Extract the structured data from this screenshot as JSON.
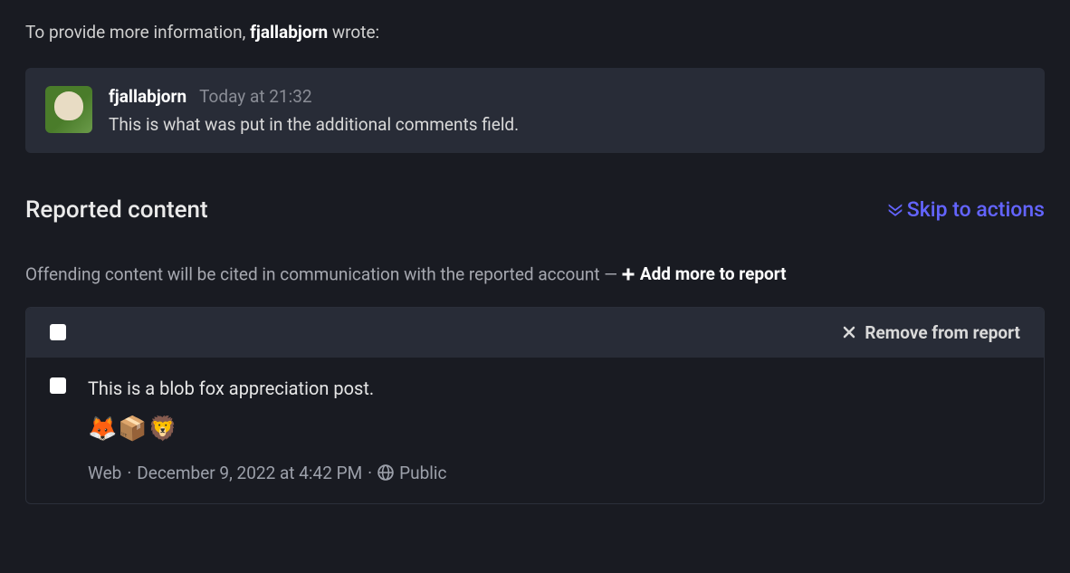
{
  "intro": {
    "prefix": "To provide more information, ",
    "author": "fjallabjorn",
    "suffix": " wrote:"
  },
  "quote": {
    "author": "fjallabjorn",
    "timestamp": "Today at 21:32",
    "body": "This is what was put in the additional comments field."
  },
  "section": {
    "title": "Reported content",
    "skip_label": "Skip to actions",
    "subheader": "Offending content will be cited in communication with the reported account — ",
    "add_more_label": "Add more to report",
    "remove_label": "Remove from report"
  },
  "post": {
    "body": "This is a blob fox appreciation post.",
    "emoji_row": "🦊📦🦁",
    "source": "Web",
    "sep1": " · ",
    "date": "December 9, 2022 at 4:42 PM",
    "sep2": " · ",
    "visibility": "Public"
  }
}
